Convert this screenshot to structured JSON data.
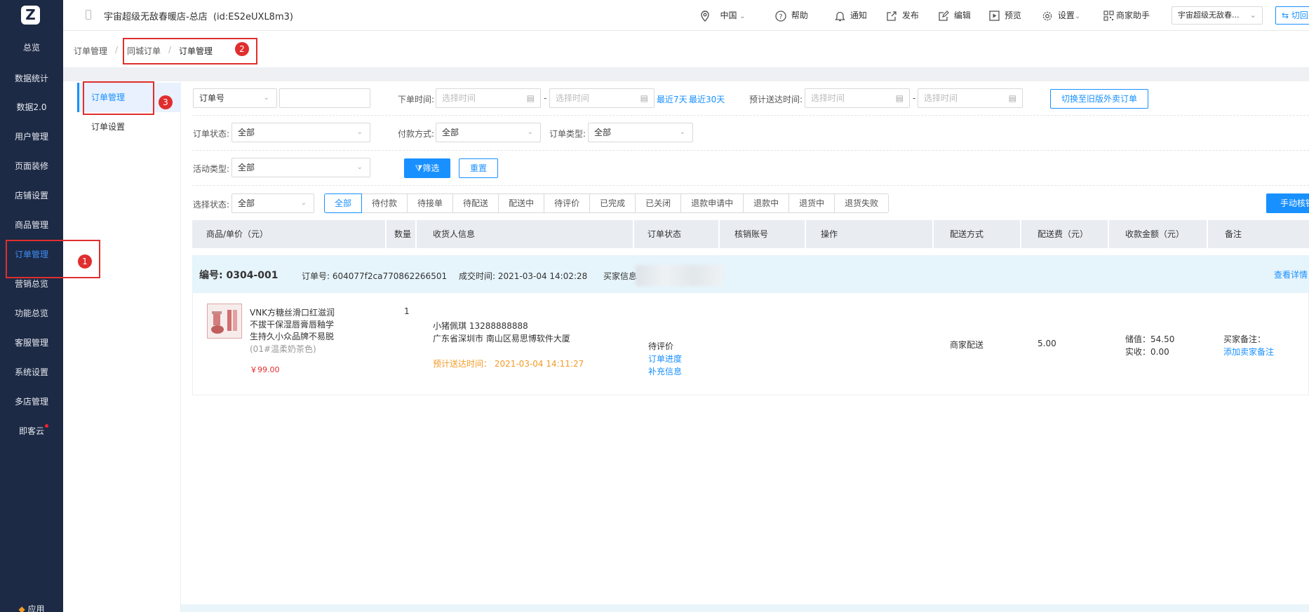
{
  "app": {
    "logo_letter": "Z"
  },
  "sidebar": {
    "items": [
      {
        "label": "总览"
      },
      {
        "label": "数据统计"
      },
      {
        "label": "数据2.0"
      },
      {
        "label": "用户管理"
      },
      {
        "label": "页面装修"
      },
      {
        "label": "店铺设置"
      },
      {
        "label": "商品管理"
      },
      {
        "label": "订单管理"
      },
      {
        "label": "营销总览"
      },
      {
        "label": "功能总览"
      },
      {
        "label": "客服管理"
      },
      {
        "label": "系统设置"
      },
      {
        "label": "多店管理"
      },
      {
        "label": "即客云"
      }
    ],
    "active_index": 7,
    "bottom_label": "应用"
  },
  "topbar": {
    "store_name": "宇宙超级无敌春暖店-总店",
    "store_id": "(id:ES2eUXL8m3)",
    "region": "中国",
    "help": "帮助",
    "notify": "通知",
    "publish": "发布",
    "edit": "编辑",
    "preview": "预览",
    "settings": "设置",
    "assistant": "商家助手",
    "store_select": "宇宙超级无敌春...",
    "switch_label": "切回"
  },
  "breadcrumb": {
    "root": "订单管理",
    "mid": "同城订单",
    "current": "订单管理"
  },
  "annotations": {
    "badge1": "1",
    "badge2": "2",
    "badge3": "3"
  },
  "subnav": {
    "items": [
      {
        "label": "订单管理"
      },
      {
        "label": "订单设置"
      }
    ]
  },
  "filters": {
    "order_no_select": "订单号",
    "order_time_label": "下单时间:",
    "date_placeholder": "选择时间",
    "recent7": "最近7天",
    "recent30": "最近30天",
    "delivery_time_label": "预计送达时间:",
    "switch_old": "切换至旧版外卖订单",
    "order_status_label": "订单状态:",
    "order_status_value": "全部",
    "pay_method_label": "付款方式:",
    "pay_method_value": "全部",
    "order_type_label": "订单类型:",
    "order_type_value": "全部",
    "activity_label": "活动类型:",
    "activity_value": "全部",
    "filter_btn": "筛选",
    "reset_btn": "重置",
    "select_status_label": "选择状态:",
    "select_status_value": "全部",
    "manual_btn": "手动核销"
  },
  "status_tabs": [
    "全部",
    "待付款",
    "待接单",
    "待配送",
    "配送中",
    "待评价",
    "已完成",
    "已关闭",
    "退款申请中",
    "退款中",
    "退货中",
    "退货失败"
  ],
  "table": {
    "headers": [
      "商品/单价（元）",
      "数量",
      "收货人信息",
      "订单状态",
      "核销账号",
      "操作",
      "配送方式",
      "配送费（元）",
      "收款金额（元）",
      "备注"
    ]
  },
  "order": {
    "code": "编号: 0304-001",
    "order_no": "订单号: 604077f2ca770862266501",
    "deal_time": "成交时间: 2021-03-04 14:02:28",
    "buyer_info_label": "买家信息",
    "view_detail": "查看详情",
    "product_name_lines": [
      "VNK方糖丝滑口红滋润",
      "不拔干保湿唇膏唇釉学",
      "生持久小众品牌不易脱"
    ],
    "product_spec": "(01#温柔奶茶色)",
    "product_price": "￥99.00",
    "quantity": "1",
    "receiver": "小猪佩琪 13288888888",
    "address": "广东省深圳市  南山区易思博软件大厦",
    "expected_time": "预计送达时间：  2021-03-04 14:11:27",
    "status": "待评价",
    "progress_link": "订单进度",
    "supplement_link": "补充信息",
    "delivery_method": "商家配送",
    "delivery_fee": "5.00",
    "stored_value": "储值：54.50",
    "actual_received": "实收：0.00",
    "buyer_note_label": "买家备注：",
    "add_seller_note": "添加卖家备注"
  },
  "colors": {
    "accent": "#1890ff",
    "nav_bg": "#1d2a45",
    "annotation_red": "#e02e2e",
    "order_head_bg": "#e6f4fb",
    "expected_time": "#f39b26",
    "price": "#e02e2e"
  }
}
